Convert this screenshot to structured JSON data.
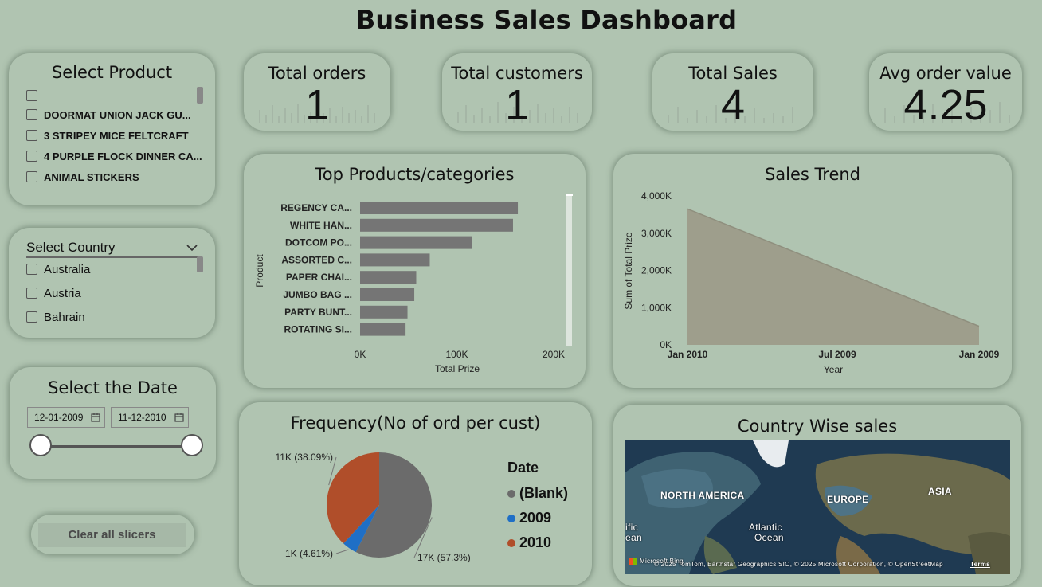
{
  "dashboard_title": "Business Sales Dashboard",
  "product_slicer": {
    "title": "Select Product",
    "items": [
      "",
      "DOORMAT UNION JACK GU...",
      "3 STRIPEY MICE FELTCRAFT",
      "4 PURPLE FLOCK DINNER CA...",
      "ANIMAL STICKERS"
    ]
  },
  "country_slicer": {
    "title": "Select Country",
    "items": [
      "Australia",
      "Austria",
      "Bahrain"
    ]
  },
  "date_slicer": {
    "title": "Select the Date",
    "start": "12-01-2009",
    "end": "11-12-2010"
  },
  "clear_button": "Clear all slicers",
  "kpis": [
    {
      "label": "Total orders",
      "value": "1"
    },
    {
      "label": "Total customers",
      "value": "1"
    },
    {
      "label": "Total Sales",
      "value": "4"
    },
    {
      "label": "Avg order value",
      "value": "4.25"
    }
  ],
  "colors": {
    "background": "#b0c4b1",
    "bar": "#757575",
    "area": "#9e9e8c",
    "blank": "#6b6b6b",
    "y2009": "#1f6fc6",
    "y2010": "#b04e2a"
  },
  "chart_data": [
    {
      "type": "bar",
      "title": "Top Products/categories",
      "categories": [
        "REGENCY CA...",
        "WHITE HAN...",
        "DOTCOM PO...",
        "ASSORTED C...",
        "PAPER CHAI...",
        "JUMBO BAG ...",
        "PARTY BUNT...",
        "ROTATING SI..."
      ],
      "values": [
        163000,
        158000,
        116000,
        72000,
        58000,
        56000,
        49000,
        47000
      ],
      "xlabel": "Total Prize",
      "ylabel": "Product",
      "xlim": [
        0,
        200000
      ],
      "xticks": [
        "0K",
        "100K",
        "200K"
      ]
    },
    {
      "type": "area",
      "title": "Sales Trend",
      "x": [
        "Jan 2010",
        "Jan 2009"
      ],
      "xticks": [
        "Jan 2010",
        "Jul 2009",
        "Jan 2009"
      ],
      "values": [
        3650000,
        500000
      ],
      "xlabel": "Year",
      "ylabel": "Sum of Total Prize",
      "ylim": [
        0,
        4000000
      ],
      "yticks": [
        "4,000K",
        "3,000K",
        "2,000K",
        "1,000K",
        "0K"
      ]
    },
    {
      "type": "pie",
      "title": "Frequency(No of ord per cust)",
      "legend_title": "Date",
      "categories": [
        "(Blank)",
        "2009",
        "2010"
      ],
      "values": [
        57.3,
        4.61,
        38.09
      ],
      "data_labels": [
        "17K (57.3%)",
        "1K (4.61%)",
        "11K (38.09%)"
      ]
    }
  ],
  "map": {
    "title": "Country Wise sales",
    "labels": [
      "NORTH AMERICA",
      "EUROPE",
      "ASIA",
      "Atlantic",
      "Ocean",
      "ific",
      "ean"
    ],
    "attribution": "© 2025 TomTom, Earthstar Geographics SIO, © 2025 Microsoft Corporation, © OpenStreetMap",
    "terms": "Terms",
    "brand": "Microsoft Bing"
  }
}
